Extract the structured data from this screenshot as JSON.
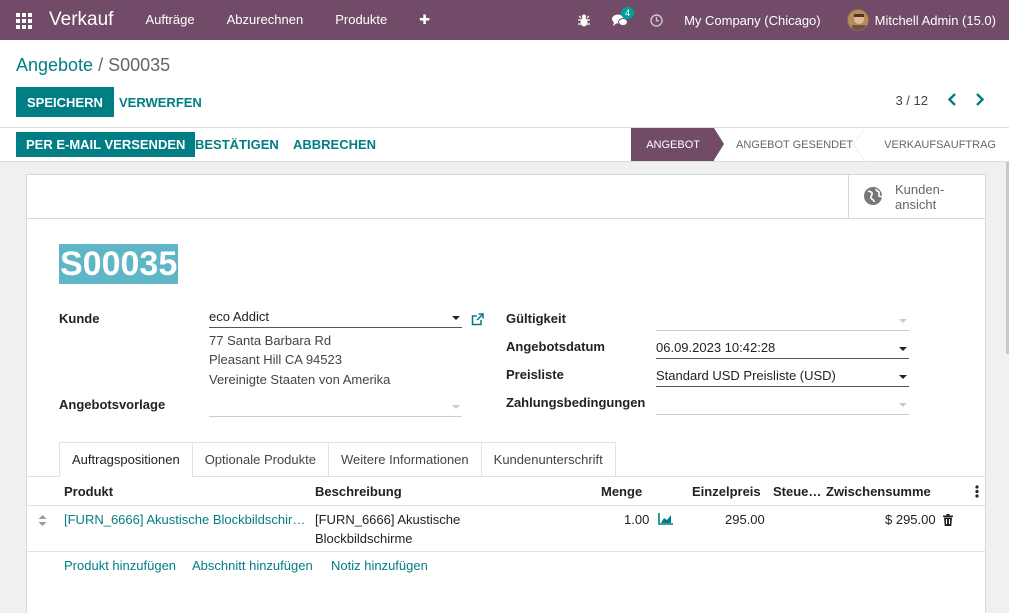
{
  "navbar": {
    "app_name": "Verkauf",
    "menu": [
      "Aufträge",
      "Abzurechnen",
      "Produkte"
    ],
    "message_count": "4",
    "company": "My Company (Chicago)",
    "user": "Mitchell Admin (15.0)",
    "brand_color": "#714b67"
  },
  "breadcrumb": {
    "parent": "Angebote",
    "separator": "/",
    "current": "S00035"
  },
  "actions": {
    "save": "Speichern",
    "discard": "Verwerfen"
  },
  "pager": {
    "value": "3 / 12"
  },
  "statusbar": {
    "buttons": [
      "Per E-Mail versenden",
      "Bestätigen",
      "Abbrechen"
    ],
    "stages": [
      "Angebot",
      "Angebot gesendet",
      "Verkaufsauftrag"
    ],
    "active_stage": "Angebot"
  },
  "smart_button": {
    "line1": "Kunden-",
    "line2": "ansicht",
    "icon": "globe-icon"
  },
  "order": {
    "name": "S00035",
    "customer_label": "Kunde",
    "customer": "eco Addict",
    "address": [
      "77 Santa Barbara Rd",
      "Pleasant Hill CA 94523",
      "Vereinigte Staaten von Amerika"
    ],
    "template_label": "Angebotsvorlage",
    "template": "",
    "validity_label": "Gültigkeit",
    "validity": "",
    "date_label": "Angebotsdatum",
    "date": "06.09.2023 10:42:28",
    "pricelist_label": "Preisliste",
    "pricelist": "Standard USD Preisliste (USD)",
    "terms_label": "Zahlungsbedingungen",
    "terms": ""
  },
  "tabs": [
    "Auftragspositionen",
    "Optionale Produkte",
    "Weitere Informationen",
    "Kundenunterschrift"
  ],
  "lines": {
    "headers": {
      "product": "Produkt",
      "description": "Beschreibung",
      "qty": "Menge",
      "price": "Einzelpreis",
      "taxes": "Steue…",
      "subtotal": "Zwischensumme"
    },
    "rows": [
      {
        "product": "[FURN_6666] Akustische Blockbildschir…",
        "description_1": "[FURN_6666] Akustische",
        "description_2": "Blockbildschirme",
        "qty": "1.00",
        "price": "295.00",
        "taxes": "",
        "subtotal": "$ 295.00"
      }
    ],
    "add_product": "Produkt hinzufügen",
    "add_section": "Abschnitt hinzufügen",
    "add_note": "Notiz hinzufügen"
  }
}
